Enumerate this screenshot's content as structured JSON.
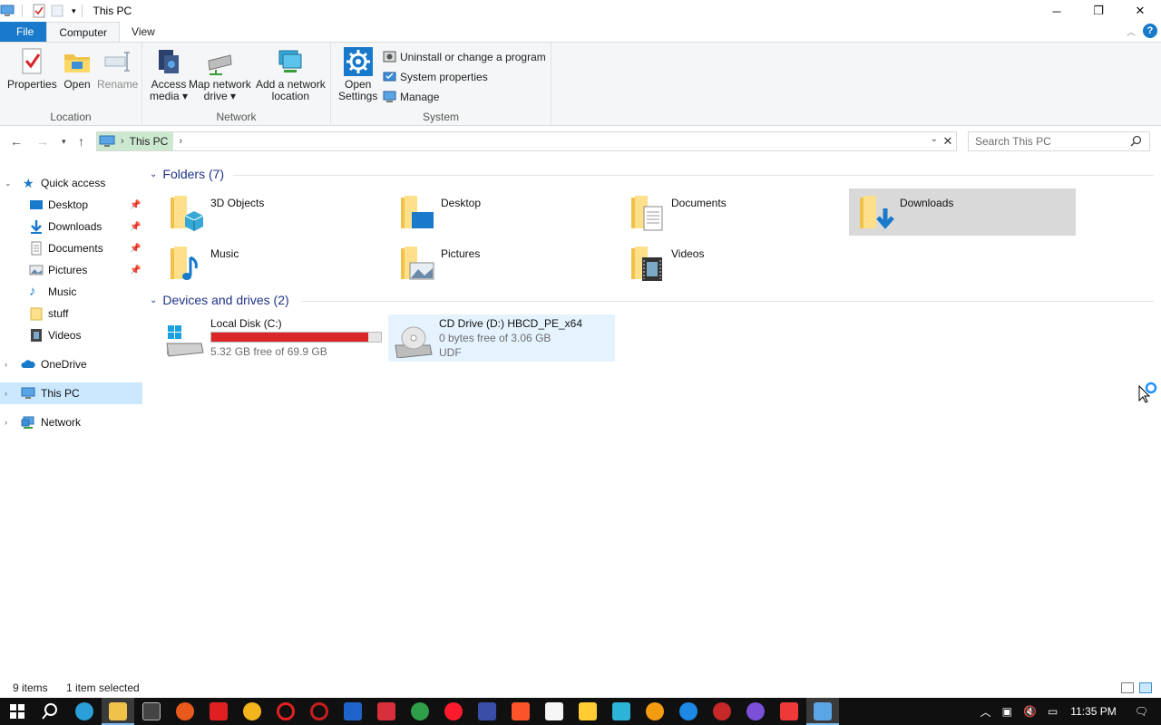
{
  "window": {
    "title": "This PC",
    "buttons": {
      "minimize": "─",
      "restore": "❐",
      "close": "✕"
    }
  },
  "ribbon_tabs": [
    "File",
    "Computer",
    "View"
  ],
  "ribbon": {
    "location": {
      "label": "Location",
      "properties": "Properties",
      "open": "Open",
      "rename": "Rename"
    },
    "network": {
      "label": "Network",
      "access_media_1": "Access",
      "access_media_2": "media ▾",
      "map_drive_1": "Map network",
      "map_drive_2": "drive ▾",
      "add_location_1": "Add a network",
      "add_location_2": "location"
    },
    "system": {
      "label": "System",
      "open_settings_1": "Open",
      "open_settings_2": "Settings",
      "uninstall": "Uninstall or change a program",
      "system_properties": "System properties",
      "manage": "Manage"
    }
  },
  "address": {
    "crumb": "This PC",
    "search_placeholder": "Search This PC"
  },
  "sidebar": {
    "quick_access": "Quick access",
    "items": [
      {
        "label": "Desktop",
        "pinned": true
      },
      {
        "label": "Downloads",
        "pinned": true
      },
      {
        "label": "Documents",
        "pinned": true
      },
      {
        "label": "Pictures",
        "pinned": true
      },
      {
        "label": "Music",
        "pinned": false
      },
      {
        "label": "stuff",
        "pinned": false
      },
      {
        "label": "Videos",
        "pinned": false
      }
    ],
    "onedrive": "OneDrive",
    "this_pc": "This PC",
    "network": "Network"
  },
  "content": {
    "folders_header": "Folders (7)",
    "folders": [
      "3D Objects",
      "Desktop",
      "Documents",
      "Downloads",
      "Music",
      "Pictures",
      "Videos"
    ],
    "drives_header": "Devices and drives (2)",
    "drives": [
      {
        "name": "Local Disk (C:)",
        "free": "5.32 GB free of 69.9 GB",
        "used_fraction": 0.924
      },
      {
        "name": "CD Drive (D:) HBCD_PE_x64",
        "free": "0 bytes free of 3.06 GB",
        "fs": "UDF"
      }
    ]
  },
  "status": {
    "items": "9 items",
    "selected": "1 item selected"
  },
  "taskbar": {
    "time": "11:35 PM"
  },
  "colors": {
    "accent": "#1979ca",
    "selection": "#cce8ff",
    "drive_bar_fill": "#da2626",
    "address_highlight": "#cce8cf",
    "section_header": "#1e3287"
  }
}
